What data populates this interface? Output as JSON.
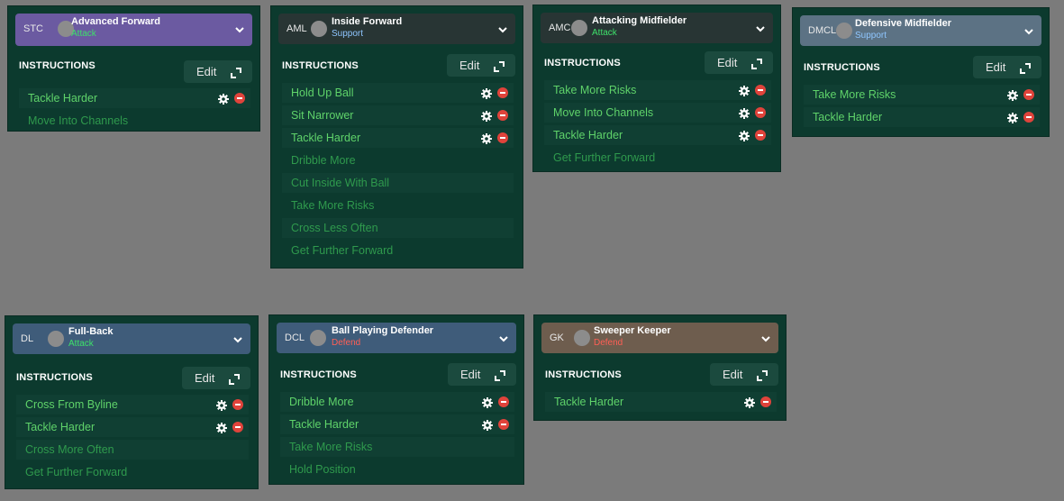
{
  "colors": {
    "attack": "#3ee06a",
    "support": "#8fc6ff",
    "defend": "#ff5f55",
    "instruction_active": "#5fd36a",
    "instruction_inactive": "#2f9a4d"
  },
  "common": {
    "instructions_heading": "INSTRUCTIONS",
    "edit_label": "Edit"
  },
  "cards": [
    {
      "position": "STC",
      "role": "Advanced Forward",
      "duty": "Attack",
      "duty_color": "#3ee06a",
      "header_color": "#6b5aa1",
      "instructions": [
        {
          "label": "Tackle Harder",
          "state": "active"
        },
        {
          "label": "Move Into Channels",
          "state": "inactive"
        }
      ]
    },
    {
      "position": "AML",
      "role": "Inside Forward",
      "duty": "Support",
      "duty_color": "#8fc6ff",
      "header_color": "#283534",
      "instructions": [
        {
          "label": "Hold Up Ball",
          "state": "active"
        },
        {
          "label": "Sit Narrower",
          "state": "active"
        },
        {
          "label": "Tackle Harder",
          "state": "active"
        },
        {
          "label": "Dribble More",
          "state": "inactive"
        },
        {
          "label": "Cut Inside With Ball",
          "state": "alt"
        },
        {
          "label": "Take More Risks",
          "state": "inactive"
        },
        {
          "label": "Cross Less Often",
          "state": "alt"
        },
        {
          "label": "Get Further Forward",
          "state": "inactive"
        }
      ]
    },
    {
      "position": "AMC",
      "role": "Attacking Midfielder",
      "duty": "Attack",
      "duty_color": "#3ee06a",
      "header_color": "#283534",
      "instructions": [
        {
          "label": "Take More Risks",
          "state": "active"
        },
        {
          "label": "Move Into Channels",
          "state": "active"
        },
        {
          "label": "Tackle Harder",
          "state": "active"
        },
        {
          "label": "Get Further Forward",
          "state": "inactive"
        }
      ]
    },
    {
      "position": "DMCL",
      "role": "Defensive Midfielder",
      "duty": "Support",
      "duty_color": "#8fc6ff",
      "header_color": "#5c7284",
      "instructions": [
        {
          "label": "Take More Risks",
          "state": "active"
        },
        {
          "label": "Tackle Harder",
          "state": "active"
        }
      ]
    },
    {
      "position": "DL",
      "role": "Full-Back",
      "duty": "Attack",
      "duty_color": "#3ee06a",
      "header_color": "#3f5c7a",
      "instructions": [
        {
          "label": "Cross From Byline",
          "state": "active"
        },
        {
          "label": "Tackle Harder",
          "state": "active"
        },
        {
          "label": "Cross More Often",
          "state": "alt"
        },
        {
          "label": "Get Further Forward",
          "state": "inactive"
        }
      ]
    },
    {
      "position": "DCL",
      "role": "Ball Playing Defender",
      "duty": "Defend",
      "duty_color": "#ff5f55",
      "header_color": "#3f5c7a",
      "instructions": [
        {
          "label": "Dribble More",
          "state": "active"
        },
        {
          "label": "Tackle Harder",
          "state": "active"
        },
        {
          "label": "Take More Risks",
          "state": "alt"
        },
        {
          "label": "Hold Position",
          "state": "inactive"
        }
      ]
    },
    {
      "position": "GK",
      "role": "Sweeper Keeper",
      "duty": "Defend",
      "duty_color": "#ff5f55",
      "header_color": "#6e5d4e",
      "instructions": [
        {
          "label": "Tackle Harder",
          "state": "active"
        }
      ]
    }
  ]
}
